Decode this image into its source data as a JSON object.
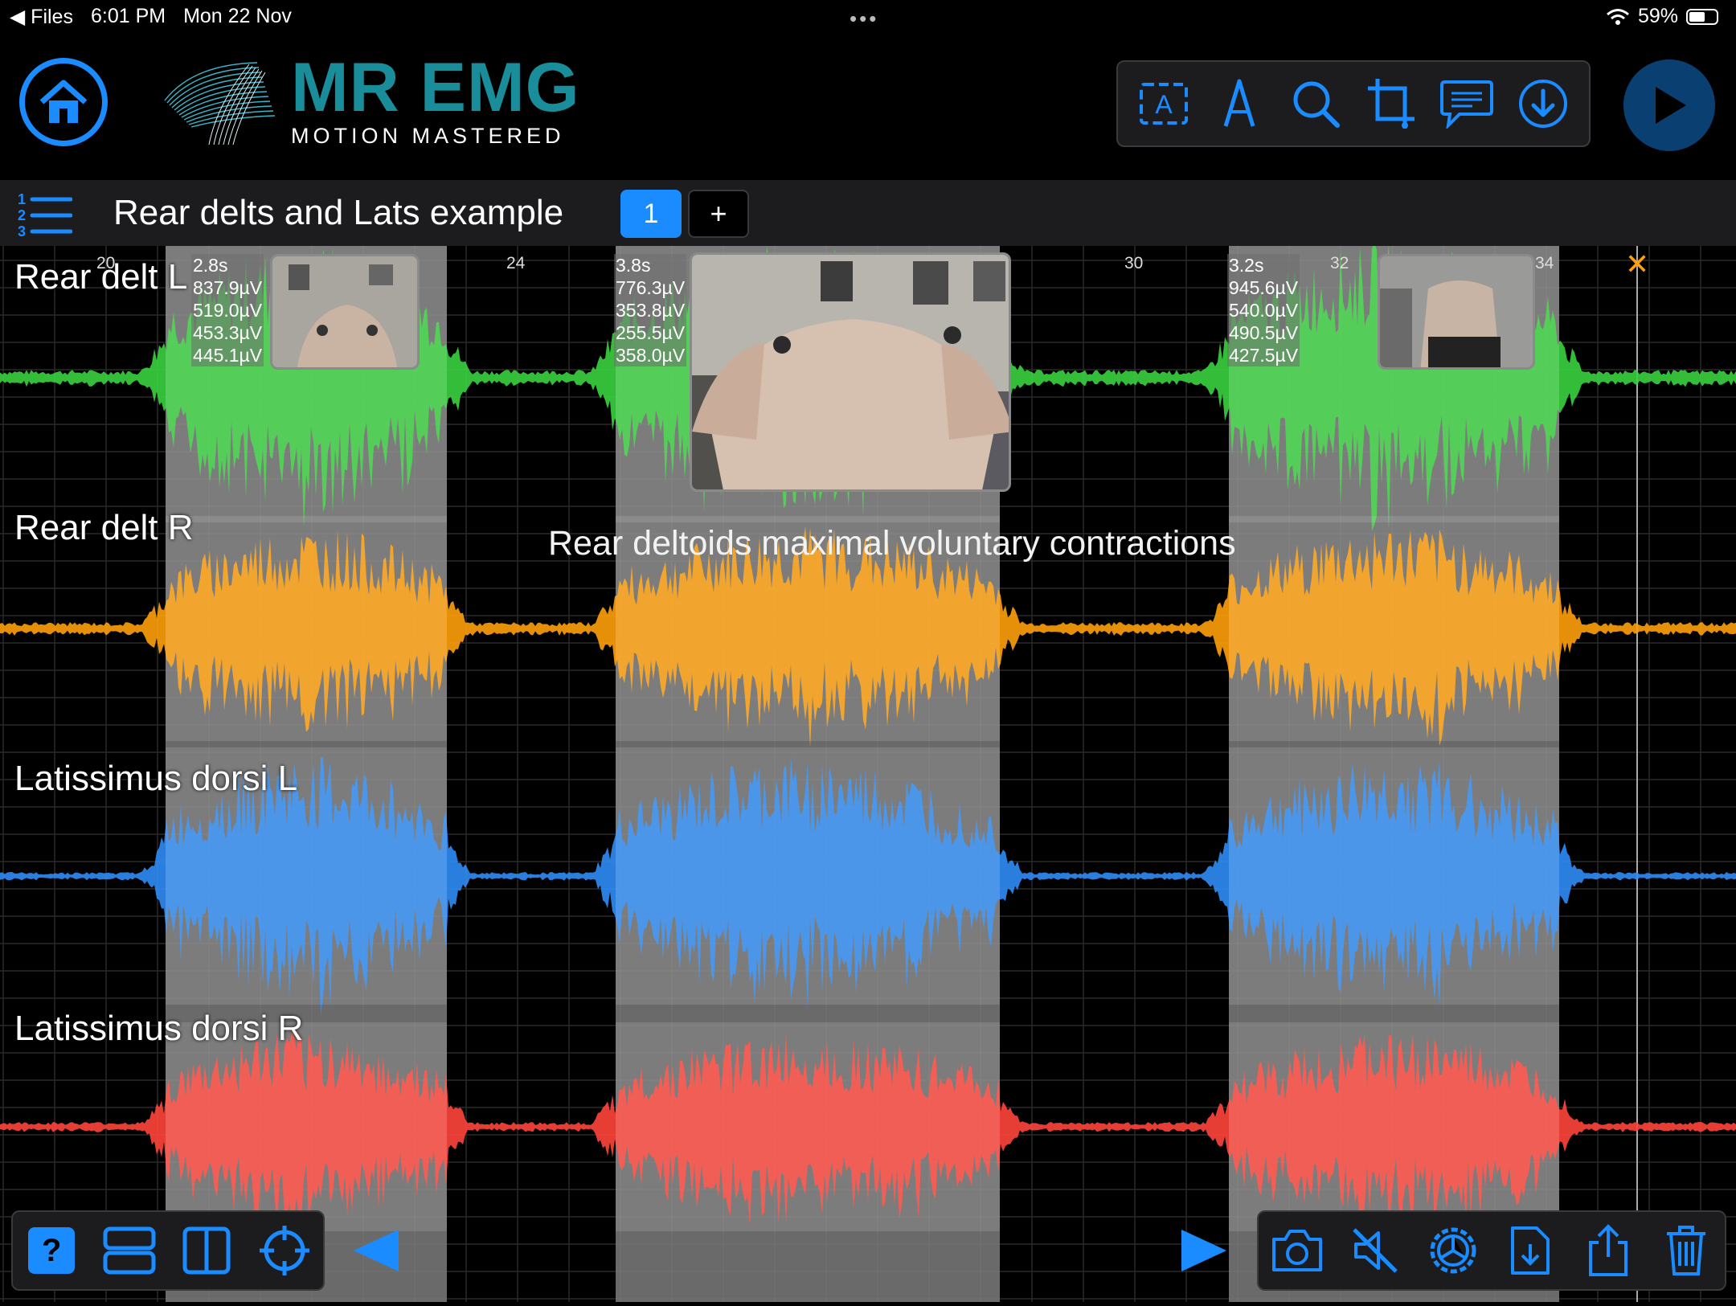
{
  "status_bar": {
    "back_app": "◀ Files",
    "time": "6:01 PM",
    "date": "Mon 22 Nov",
    "battery": "59%",
    "battery_level": 0.59
  },
  "header": {
    "logo_title": "MR EMG",
    "logo_subtitle": "MOTION MASTERED",
    "tools": [
      "text-box-icon",
      "pen-icon",
      "search-icon",
      "crop-icon",
      "comment-icon",
      "download-icon"
    ]
  },
  "session": {
    "title": "Rear delts and Lats example",
    "page_label": "1",
    "add_label": "+"
  },
  "plot": {
    "ticks": [
      "20",
      "24",
      "30",
      "32",
      "34"
    ],
    "close_marker": "✕",
    "annotation": "Rear deltoids maximal voluntary contractions",
    "colors": {
      "rear_delt_l": "#3ad13f",
      "rear_delt_r": "#ff9f0a",
      "lat_l": "#2f8cf5",
      "lat_r": "#ff453a",
      "accent": "#1a8cff"
    }
  },
  "channels": [
    {
      "label": "Rear delt L"
    },
    {
      "label": "Rear delt R"
    },
    {
      "label": "Latissimus dorsi L"
    },
    {
      "label": "Latissimus dorsi R"
    }
  ],
  "segments": [
    {
      "duration": "2.8s",
      "values": [
        "837.9µV",
        "519.0µV",
        "453.3µV",
        "445.1µV"
      ]
    },
    {
      "duration": "3.8s",
      "values": [
        "776.3µV",
        "353.8µV",
        "255.5µV",
        "358.0µV"
      ]
    },
    {
      "duration": "3.2s",
      "values": [
        "945.6µV",
        "540.0µV",
        "490.5µV",
        "427.5µV"
      ]
    }
  ],
  "bottom_left_tools": [
    "help-icon",
    "stacked-layout-icon",
    "split-layout-icon",
    "crosshair-icon",
    "previous-icon"
  ],
  "bottom_right_tools": [
    "next-icon",
    "camera-icon",
    "mute-icon",
    "settings-icon",
    "export-file-icon",
    "share-icon",
    "trash-icon"
  ],
  "help_label": "?"
}
